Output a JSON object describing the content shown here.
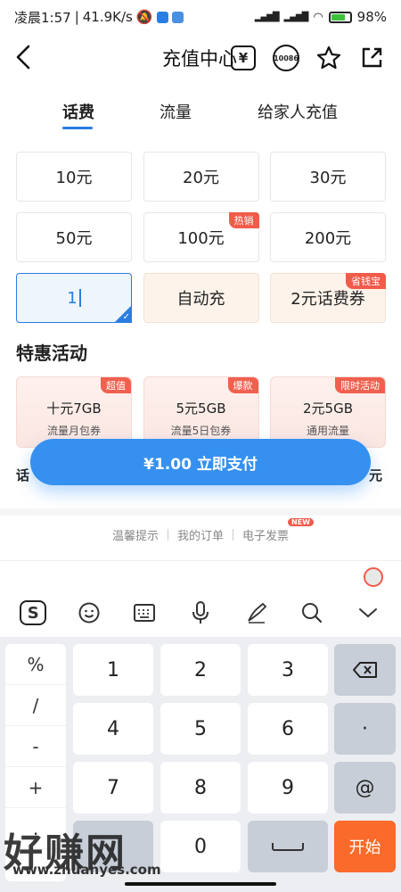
{
  "status_bar": {
    "time": "凌晨1:57",
    "speed": "41.9K/s",
    "battery": "98%"
  },
  "header": {
    "title": "充值中心",
    "yen_glyph": "¥",
    "service_number": "10086"
  },
  "tabs": [
    {
      "label": "话费",
      "active": true
    },
    {
      "label": "流量",
      "active": false
    },
    {
      "label": "给家人充值",
      "active": false
    }
  ],
  "amounts": [
    {
      "label": "10元",
      "tag": ""
    },
    {
      "label": "20元",
      "tag": ""
    },
    {
      "label": "30元",
      "tag": ""
    },
    {
      "label": "50元",
      "tag": ""
    },
    {
      "label": "100元",
      "tag": "热销"
    },
    {
      "label": "200元",
      "tag": ""
    }
  ],
  "custom_amount": {
    "value": "1"
  },
  "promo_cells": [
    {
      "label": "自动充",
      "tag": ""
    },
    {
      "label": "2元话费券",
      "tag": "省钱宝"
    }
  ],
  "deals_section": {
    "title": "特惠活动",
    "items": [
      {
        "title": "十元7GB",
        "sub": "流量月包券",
        "tag": "超值"
      },
      {
        "title": "5元5GB",
        "sub": "流量5日包券",
        "tag": "爆款"
      },
      {
        "title": "2元5GB",
        "sub": "通用流量",
        "tag": "限时活动"
      }
    ],
    "partial_left": "话",
    "partial_right": "元"
  },
  "pay_button": {
    "label": "¥1.00  立即支付"
  },
  "footer_links": {
    "tips": "温馨提示",
    "orders": "我的订单",
    "invoice": "电子发票",
    "new_badge": "NEW"
  },
  "keyboard": {
    "symbols": [
      "%",
      "/",
      "-",
      "+",
      "."
    ],
    "digits": [
      "1",
      "2",
      "3",
      "4",
      "5",
      "6",
      "7",
      "8",
      "9"
    ],
    "zero": "0",
    "dot": "·",
    "at": "@",
    "start": "开始",
    "backspace_glyph": "⌫",
    "logo_letter": "S",
    "toolbar_icons": [
      "sogou-icon",
      "emoji-icon",
      "keyboard-icon",
      "microphone-icon",
      "handwriting-icon",
      "search-icon",
      "collapse-icon"
    ]
  },
  "watermark": {
    "brand": "好赚网",
    "url": "www.zhuanyes.com"
  }
}
